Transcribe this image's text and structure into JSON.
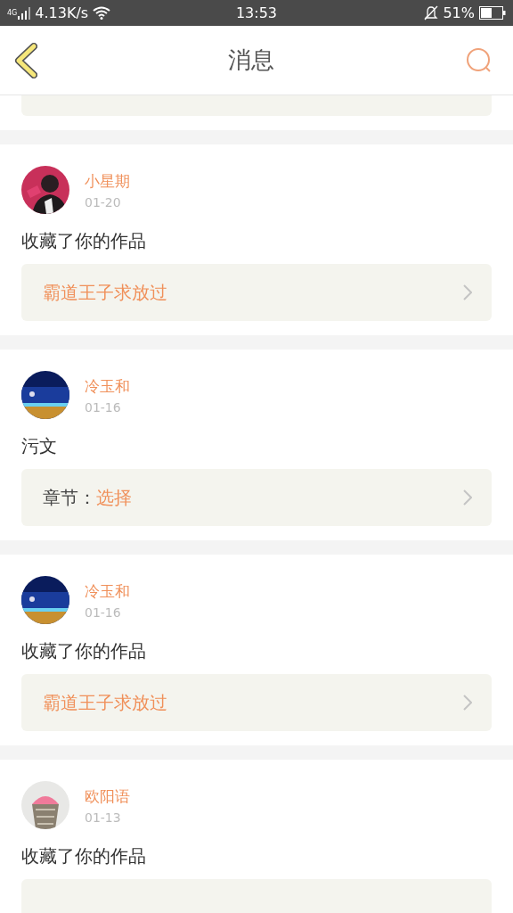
{
  "status_bar": {
    "network": "4G",
    "speed": "4.13K/s",
    "time": "13:53",
    "battery": "51%"
  },
  "nav": {
    "title": "消息"
  },
  "messages": [
    {
      "name": "小星期",
      "date": "01-20",
      "text": "收藏了你的作品",
      "link": {
        "kind": "work",
        "title": "霸道王子求放过"
      }
    },
    {
      "name": "冷玉和",
      "date": "01-16",
      "text": "污文",
      "link": {
        "kind": "chapter",
        "label": "章节：",
        "value": "选择"
      }
    },
    {
      "name": "冷玉和",
      "date": "01-16",
      "text": "收藏了你的作品",
      "link": {
        "kind": "work",
        "title": "霸道王子求放过"
      }
    },
    {
      "name": "欧阳语",
      "date": "01-13",
      "text": "收藏了你的作品"
    }
  ]
}
